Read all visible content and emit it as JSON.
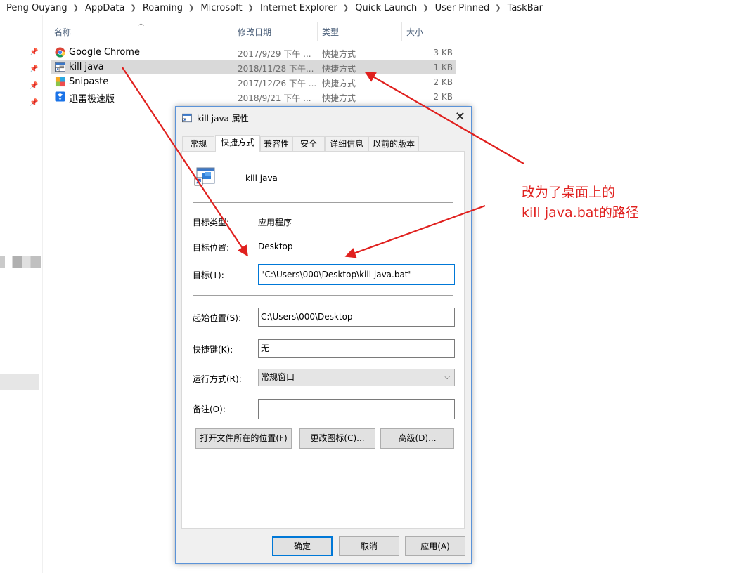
{
  "breadcrumb": [
    "Peng Ouyang",
    "AppData",
    "Roaming",
    "Microsoft",
    "Internet Explorer",
    "Quick Launch",
    "User Pinned",
    "TaskBar"
  ],
  "columns": {
    "name": "名称",
    "modified": "修改日期",
    "type": "类型",
    "size": "大小"
  },
  "files": [
    {
      "name": "Google Chrome",
      "modified": "2017/9/29 下午 ...",
      "type": "快捷方式",
      "size": "3 KB",
      "icon": "chrome-icon",
      "selected": false
    },
    {
      "name": "kill java",
      "modified": "2018/11/28 下午...",
      "type": "快捷方式",
      "size": "1 KB",
      "icon": "shortcut-icon",
      "selected": true
    },
    {
      "name": "Snipaste",
      "modified": "2017/12/26 下午 ...",
      "type": "快捷方式",
      "size": "2 KB",
      "icon": "snipaste-icon",
      "selected": false
    },
    {
      "name": "迅雷极速版",
      "modified": "2018/9/21 下午 ...",
      "type": "快捷方式",
      "size": "2 KB",
      "icon": "xunlei-icon",
      "selected": false
    }
  ],
  "dialog": {
    "title": "kill java 属性",
    "tabs": [
      "常规",
      "快捷方式",
      "兼容性",
      "安全",
      "详细信息",
      "以前的版本"
    ],
    "active_tab": "快捷方式",
    "shortcut_name": "kill java",
    "target_type_label": "目标类型:",
    "target_type": "应用程序",
    "target_location_label": "目标位置:",
    "target_location": "Desktop",
    "target_label": "目标(T):",
    "target": "\"C:\\Users\\000\\Desktop\\kill java.bat\"",
    "start_in_label": "起始位置(S):",
    "start_in": "C:\\Users\\000\\Desktop",
    "hotkey_label": "快捷键(K):",
    "hotkey": "无",
    "run_label": "运行方式(R):",
    "run": "常规窗口",
    "comment_label": "备注(O):",
    "comment": "",
    "open_location_button": "打开文件所在的位置(F)",
    "change_icon_button": "更改图标(C)...",
    "advanced_button": "高级(D)...",
    "ok_button": "确定",
    "cancel_button": "取消",
    "apply_button": "应用(A)"
  },
  "annotation": {
    "line1": "改为了桌面上的",
    "line2": "kill java.bat的路径",
    "color": "#e0201e"
  }
}
